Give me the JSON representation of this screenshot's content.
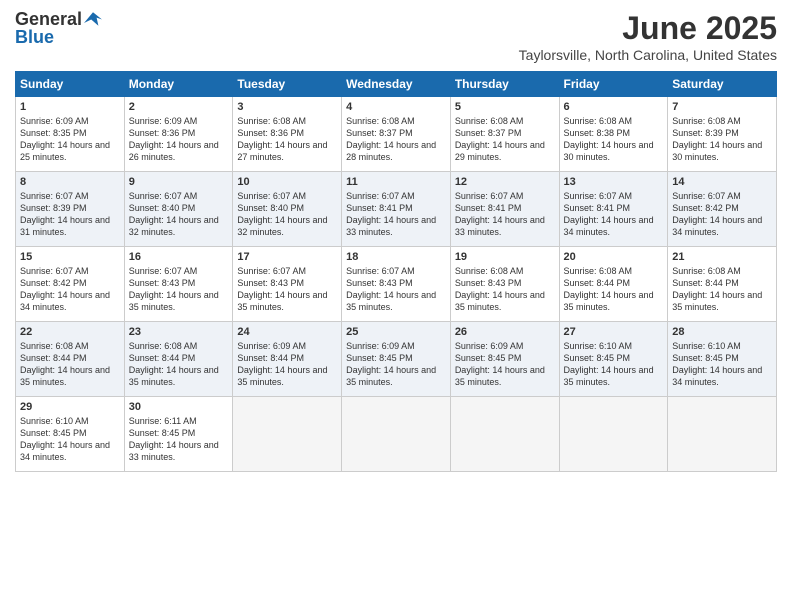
{
  "header": {
    "logo_general": "General",
    "logo_blue": "Blue",
    "month_title": "June 2025",
    "location": "Taylorsville, North Carolina, United States"
  },
  "weekdays": [
    "Sunday",
    "Monday",
    "Tuesday",
    "Wednesday",
    "Thursday",
    "Friday",
    "Saturday"
  ],
  "weeks": [
    [
      {
        "day": "1",
        "sunrise": "Sunrise: 6:09 AM",
        "sunset": "Sunset: 8:35 PM",
        "daylight": "Daylight: 14 hours and 25 minutes."
      },
      {
        "day": "2",
        "sunrise": "Sunrise: 6:09 AM",
        "sunset": "Sunset: 8:36 PM",
        "daylight": "Daylight: 14 hours and 26 minutes."
      },
      {
        "day": "3",
        "sunrise": "Sunrise: 6:08 AM",
        "sunset": "Sunset: 8:36 PM",
        "daylight": "Daylight: 14 hours and 27 minutes."
      },
      {
        "day": "4",
        "sunrise": "Sunrise: 6:08 AM",
        "sunset": "Sunset: 8:37 PM",
        "daylight": "Daylight: 14 hours and 28 minutes."
      },
      {
        "day": "5",
        "sunrise": "Sunrise: 6:08 AM",
        "sunset": "Sunset: 8:37 PM",
        "daylight": "Daylight: 14 hours and 29 minutes."
      },
      {
        "day": "6",
        "sunrise": "Sunrise: 6:08 AM",
        "sunset": "Sunset: 8:38 PM",
        "daylight": "Daylight: 14 hours and 30 minutes."
      },
      {
        "day": "7",
        "sunrise": "Sunrise: 6:08 AM",
        "sunset": "Sunset: 8:39 PM",
        "daylight": "Daylight: 14 hours and 30 minutes."
      }
    ],
    [
      {
        "day": "8",
        "sunrise": "Sunrise: 6:07 AM",
        "sunset": "Sunset: 8:39 PM",
        "daylight": "Daylight: 14 hours and 31 minutes."
      },
      {
        "day": "9",
        "sunrise": "Sunrise: 6:07 AM",
        "sunset": "Sunset: 8:40 PM",
        "daylight": "Daylight: 14 hours and 32 minutes."
      },
      {
        "day": "10",
        "sunrise": "Sunrise: 6:07 AM",
        "sunset": "Sunset: 8:40 PM",
        "daylight": "Daylight: 14 hours and 32 minutes."
      },
      {
        "day": "11",
        "sunrise": "Sunrise: 6:07 AM",
        "sunset": "Sunset: 8:41 PM",
        "daylight": "Daylight: 14 hours and 33 minutes."
      },
      {
        "day": "12",
        "sunrise": "Sunrise: 6:07 AM",
        "sunset": "Sunset: 8:41 PM",
        "daylight": "Daylight: 14 hours and 33 minutes."
      },
      {
        "day": "13",
        "sunrise": "Sunrise: 6:07 AM",
        "sunset": "Sunset: 8:41 PM",
        "daylight": "Daylight: 14 hours and 34 minutes."
      },
      {
        "day": "14",
        "sunrise": "Sunrise: 6:07 AM",
        "sunset": "Sunset: 8:42 PM",
        "daylight": "Daylight: 14 hours and 34 minutes."
      }
    ],
    [
      {
        "day": "15",
        "sunrise": "Sunrise: 6:07 AM",
        "sunset": "Sunset: 8:42 PM",
        "daylight": "Daylight: 14 hours and 34 minutes."
      },
      {
        "day": "16",
        "sunrise": "Sunrise: 6:07 AM",
        "sunset": "Sunset: 8:43 PM",
        "daylight": "Daylight: 14 hours and 35 minutes."
      },
      {
        "day": "17",
        "sunrise": "Sunrise: 6:07 AM",
        "sunset": "Sunset: 8:43 PM",
        "daylight": "Daylight: 14 hours and 35 minutes."
      },
      {
        "day": "18",
        "sunrise": "Sunrise: 6:07 AM",
        "sunset": "Sunset: 8:43 PM",
        "daylight": "Daylight: 14 hours and 35 minutes."
      },
      {
        "day": "19",
        "sunrise": "Sunrise: 6:08 AM",
        "sunset": "Sunset: 8:43 PM",
        "daylight": "Daylight: 14 hours and 35 minutes."
      },
      {
        "day": "20",
        "sunrise": "Sunrise: 6:08 AM",
        "sunset": "Sunset: 8:44 PM",
        "daylight": "Daylight: 14 hours and 35 minutes."
      },
      {
        "day": "21",
        "sunrise": "Sunrise: 6:08 AM",
        "sunset": "Sunset: 8:44 PM",
        "daylight": "Daylight: 14 hours and 35 minutes."
      }
    ],
    [
      {
        "day": "22",
        "sunrise": "Sunrise: 6:08 AM",
        "sunset": "Sunset: 8:44 PM",
        "daylight": "Daylight: 14 hours and 35 minutes."
      },
      {
        "day": "23",
        "sunrise": "Sunrise: 6:08 AM",
        "sunset": "Sunset: 8:44 PM",
        "daylight": "Daylight: 14 hours and 35 minutes."
      },
      {
        "day": "24",
        "sunrise": "Sunrise: 6:09 AM",
        "sunset": "Sunset: 8:44 PM",
        "daylight": "Daylight: 14 hours and 35 minutes."
      },
      {
        "day": "25",
        "sunrise": "Sunrise: 6:09 AM",
        "sunset": "Sunset: 8:45 PM",
        "daylight": "Daylight: 14 hours and 35 minutes."
      },
      {
        "day": "26",
        "sunrise": "Sunrise: 6:09 AM",
        "sunset": "Sunset: 8:45 PM",
        "daylight": "Daylight: 14 hours and 35 minutes."
      },
      {
        "day": "27",
        "sunrise": "Sunrise: 6:10 AM",
        "sunset": "Sunset: 8:45 PM",
        "daylight": "Daylight: 14 hours and 35 minutes."
      },
      {
        "day": "28",
        "sunrise": "Sunrise: 6:10 AM",
        "sunset": "Sunset: 8:45 PM",
        "daylight": "Daylight: 14 hours and 34 minutes."
      }
    ],
    [
      {
        "day": "29",
        "sunrise": "Sunrise: 6:10 AM",
        "sunset": "Sunset: 8:45 PM",
        "daylight": "Daylight: 14 hours and 34 minutes."
      },
      {
        "day": "30",
        "sunrise": "Sunrise: 6:11 AM",
        "sunset": "Sunset: 8:45 PM",
        "daylight": "Daylight: 14 hours and 33 minutes."
      },
      null,
      null,
      null,
      null,
      null
    ]
  ]
}
